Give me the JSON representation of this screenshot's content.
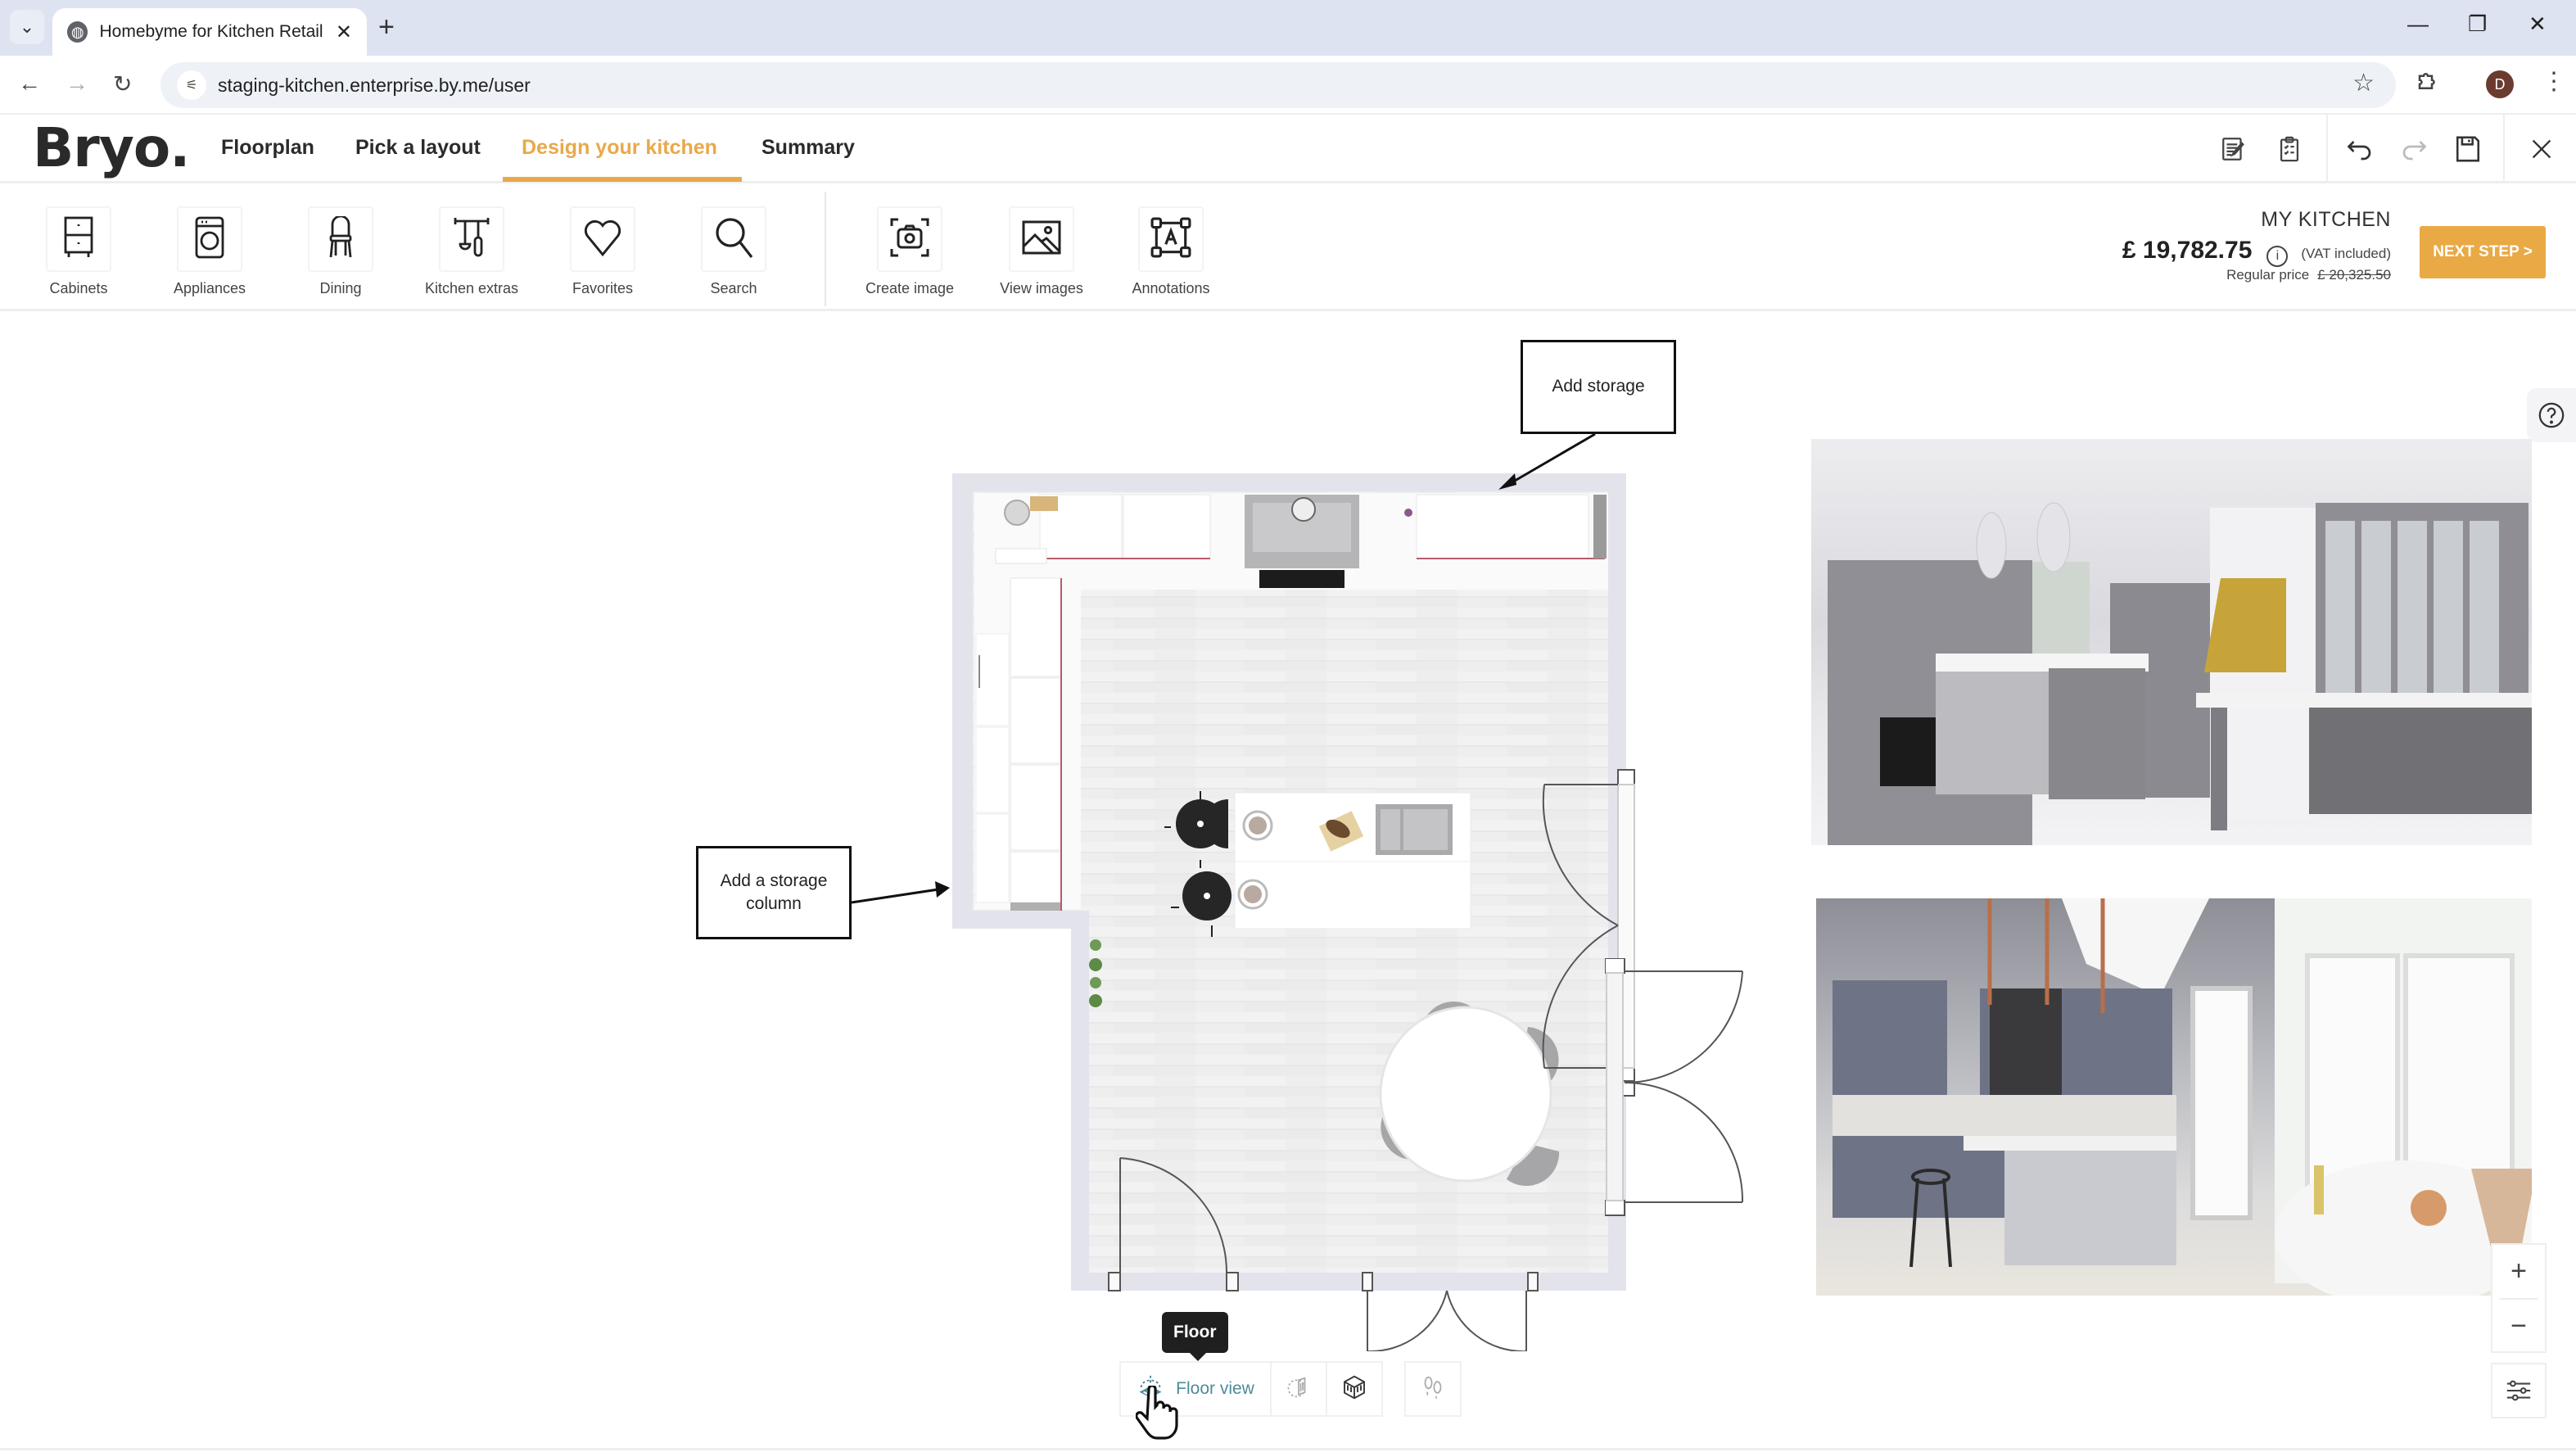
{
  "browser": {
    "tab_title": "Homebyme for Kitchen Retailer",
    "url": "staging-kitchen.enterprise.by.me/user",
    "profile_initial": "D",
    "icons": {
      "tab_menu": "chevron-down-icon",
      "tab_favicon": "globe-icon",
      "tab_close": "close-icon",
      "new_tab": "plus-icon",
      "minimize": "minimize-icon",
      "restore": "restore-icon",
      "close_window": "close-icon",
      "back": "arrow-left-icon",
      "forward": "arrow-right-icon",
      "reload": "reload-icon",
      "site_info": "tune-icon",
      "bookmark": "star-icon",
      "extensions": "puzzle-icon",
      "menu": "kebab-icon"
    }
  },
  "header": {
    "logo": "Bryo.",
    "nav": [
      {
        "label": "Floorplan",
        "active": false
      },
      {
        "label": "Pick a layout",
        "active": false
      },
      {
        "label": "Design your kitchen",
        "active": true
      },
      {
        "label": "Summary",
        "active": false
      }
    ],
    "actions": [
      "notes-icon",
      "checklist-icon",
      "undo-icon",
      "redo-icon",
      "save-icon",
      "close-icon"
    ],
    "accent_color": "#e8a94a"
  },
  "toolbar": {
    "catalog_tools": [
      {
        "label": "Cabinets",
        "icon": "cabinet-icon"
      },
      {
        "label": "Appliances",
        "icon": "washing-machine-icon"
      },
      {
        "label": "Dining",
        "icon": "chair-icon"
      },
      {
        "label": "Kitchen extras",
        "icon": "utensils-icon"
      },
      {
        "label": "Favorites",
        "icon": "heart-icon"
      },
      {
        "label": "Search",
        "icon": "search-icon"
      }
    ],
    "image_tools": [
      {
        "label": "Create image",
        "icon": "camera-icon"
      },
      {
        "label": "View images",
        "icon": "image-icon"
      },
      {
        "label": "Annotations",
        "icon": "annotation-icon"
      }
    ],
    "summary": {
      "kitchen_name": "MY KITCHEN",
      "price": "£ 19,782.75",
      "vat_note": "(VAT included)",
      "regular_label": "Regular price",
      "regular_price": "£ 20,325.50"
    },
    "next_step_label": "NEXT STEP >",
    "next_step_color": "#e9a945"
  },
  "canvas": {
    "annotations": [
      {
        "text": "Add storage"
      },
      {
        "text": "Add a storage column"
      }
    ],
    "photos": [
      {
        "alt": "Grey kitchen with brass hood render"
      },
      {
        "alt": "Grey kitchen with skylight render"
      }
    ],
    "tooltip": "Floor",
    "view_modes": [
      {
        "label": "Floor view",
        "icon": "floor-view-icon",
        "active": true
      },
      {
        "label": "",
        "icon": "wall-view-icon",
        "active": false
      },
      {
        "label": "",
        "icon": "3d-room-icon",
        "active": false
      },
      {
        "label": "",
        "icon": "walk-footprints-icon",
        "active": false
      }
    ],
    "zoom_in": "+",
    "zoom_out": "−",
    "help_icon": "help-icon",
    "settings_icon": "sliders-icon"
  }
}
